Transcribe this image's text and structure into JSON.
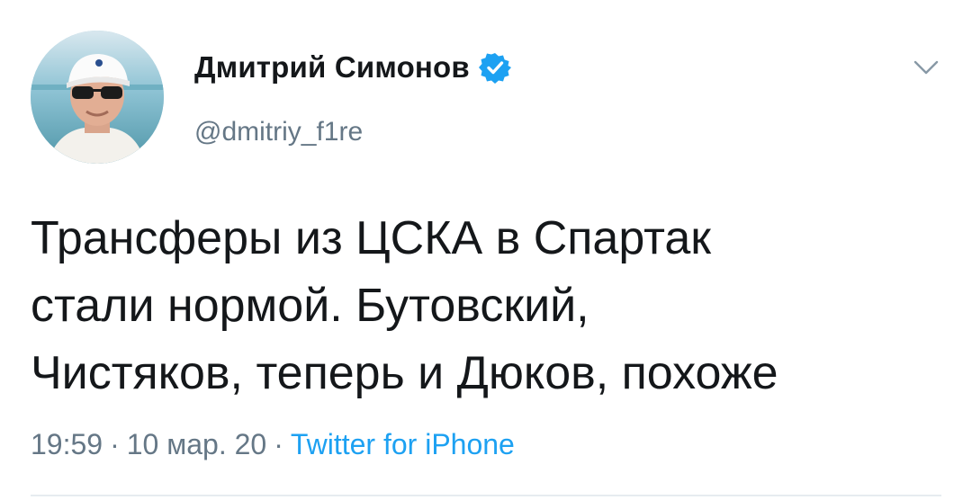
{
  "author": {
    "name": "Дмитрий Симонов",
    "handle": "@dmitriy_f1re",
    "verified": true
  },
  "tweet": {
    "lines": [
      "Трансферы из ЦСКА в Спартак",
      "стали нормой. Бутовский,",
      "Чистяков, теперь и Дюков, похоже"
    ]
  },
  "meta": {
    "time": "19:59",
    "separator": "·",
    "date": "10 мар. 20",
    "source": "Twitter for iPhone"
  },
  "icons": {
    "verified": "verified-badge-icon",
    "menu": "chevron-down-icon"
  },
  "colors": {
    "text": "#14171a",
    "secondary": "#657786",
    "accent": "#1da1f2",
    "divider": "#e6ecf0"
  }
}
